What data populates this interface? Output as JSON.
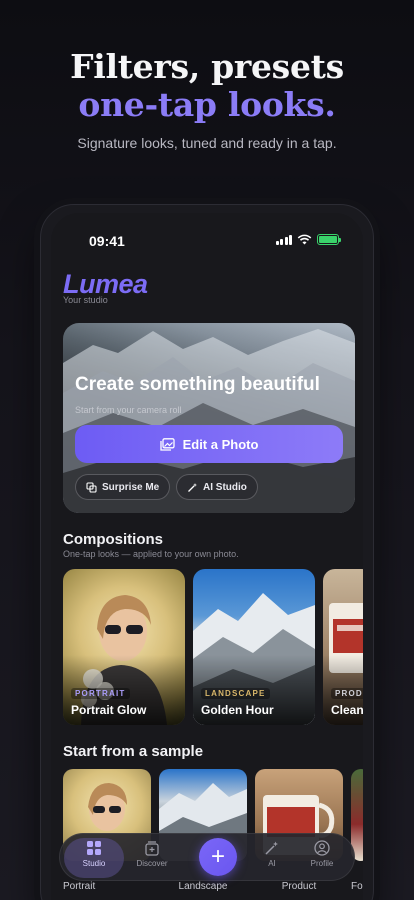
{
  "hero": {
    "title_line1": "Filters, presets",
    "title_line2": "one-tap looks.",
    "subtitle": "Signature looks, tuned and ready in a tap."
  },
  "status_bar": {
    "time": "09:41"
  },
  "app": {
    "logo": "Lumea",
    "tagline": "Your studio",
    "accent_color": "#7c6cf5"
  },
  "feature": {
    "title": "Create something beautiful",
    "subtitle": "Start from your camera roll",
    "primary_button": "Edit a Photo",
    "chips": [
      "Surprise Me",
      "AI Studio"
    ]
  },
  "compositions": {
    "title": "Compositions",
    "subtitle": "One-tap looks — applied to your own photo.",
    "cards": [
      {
        "tag": "PORTRAIT",
        "label": "Portrait Glow",
        "tag_color": "#a99cf8"
      },
      {
        "tag": "LANDSCAPE",
        "label": "Golden Hour",
        "tag_color": "#d9b76a"
      },
      {
        "tag": "PRODUCT",
        "label": "Clean",
        "tag_color": "#d0d0d6"
      }
    ]
  },
  "samples": {
    "title": "Start from a sample",
    "items": [
      "Portrait",
      "Landscape",
      "Product",
      "Food"
    ]
  },
  "tabbar": {
    "items": [
      "Studio",
      "Discover",
      "AI",
      "Profile"
    ],
    "fab_label": "+"
  }
}
